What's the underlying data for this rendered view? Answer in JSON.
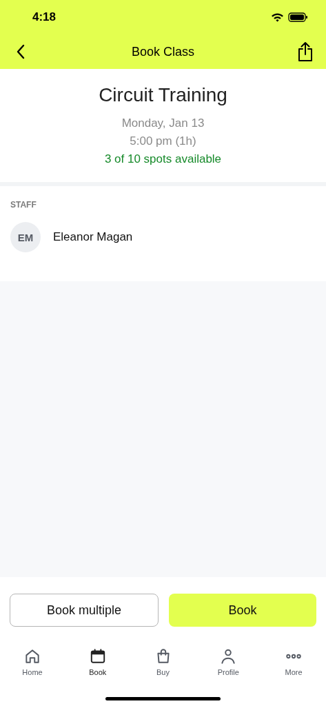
{
  "status_bar": {
    "time": "4:18"
  },
  "nav": {
    "title": "Book Class"
  },
  "class": {
    "name": "Circuit Training",
    "date": "Monday, Jan 13",
    "time": "5:00 pm (1h)",
    "availability": "3 of 10 spots available"
  },
  "staff": {
    "heading": "STAFF",
    "members": [
      {
        "initials": "EM",
        "name": "Eleanor Magan"
      }
    ]
  },
  "actions": [
    {
      "label": "Book multiple",
      "kind": "secondary"
    },
    {
      "label": "Book",
      "kind": "primary"
    }
  ],
  "tabs": [
    {
      "label": "Home",
      "kind": "home",
      "selected": false
    },
    {
      "label": "Book",
      "kind": "calendar",
      "selected": true
    },
    {
      "label": "Buy",
      "kind": "bag",
      "selected": false
    },
    {
      "label": "Profile",
      "kind": "person",
      "selected": false
    },
    {
      "label": "More",
      "kind": "more",
      "selected": false
    }
  ]
}
